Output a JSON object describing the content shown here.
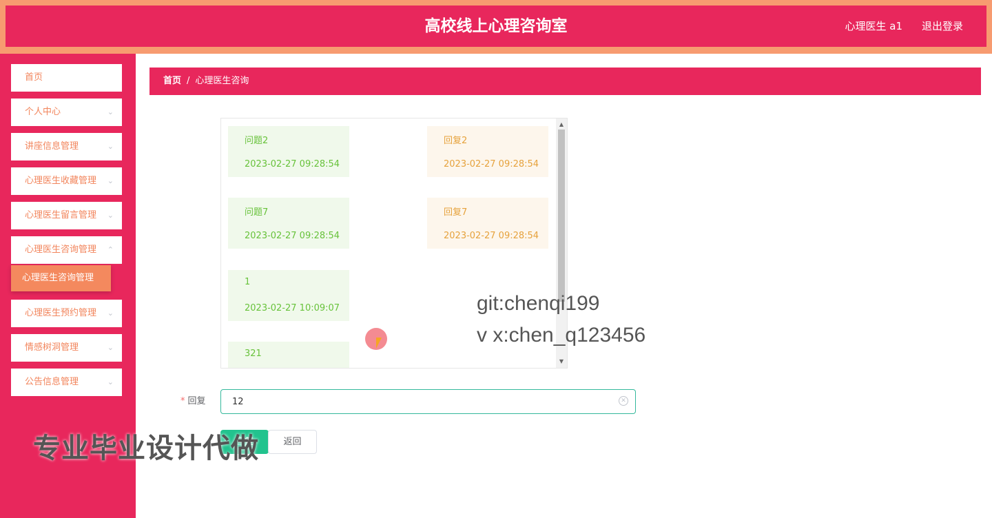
{
  "header": {
    "title": "高校线上心理咨询室",
    "user_label": "心理医生 a1",
    "logout_label": "退出登录"
  },
  "sidebar": {
    "items": [
      {
        "label": "首页"
      },
      {
        "label": "个人中心"
      },
      {
        "label": "讲座信息管理"
      },
      {
        "label": "心理医生收藏管理"
      },
      {
        "label": "心理医生留言管理"
      },
      {
        "label": "心理医生咨询管理"
      },
      {
        "label": "心理医生预约管理"
      },
      {
        "label": "情感树洞管理"
      },
      {
        "label": "公告信息管理"
      }
    ],
    "active_sub": "心理医生咨询管理"
  },
  "breadcrumb": {
    "home": "首页",
    "separator": "/",
    "current": "心理医生咨询"
  },
  "chat": {
    "messages": [
      {
        "text": "问题2",
        "time": "2023-02-27 09:28:54"
      },
      {
        "text": "回复2",
        "time": "2023-02-27 09:28:54"
      },
      {
        "text": "问题7",
        "time": "2023-02-27 09:28:54"
      },
      {
        "text": "回复7",
        "time": "2023-02-27 09:28:54"
      },
      {
        "text": "1",
        "time": "2023-02-27 10:09:07"
      },
      {
        "text": "321",
        "time": ""
      }
    ]
  },
  "watermark": {
    "line1": "git:chenqi199",
    "line2": "v x:chen_q123456",
    "banner": "专业毕业设计代做"
  },
  "form": {
    "reply_label": "回复",
    "required_mark": "*",
    "reply_value": "12",
    "submit_label": "回复",
    "back_label": "返回"
  },
  "colors": {
    "primary": "#e8275c",
    "header_border": "#f79b70",
    "menu_text": "#f2855c",
    "submit": "#22c38e"
  }
}
